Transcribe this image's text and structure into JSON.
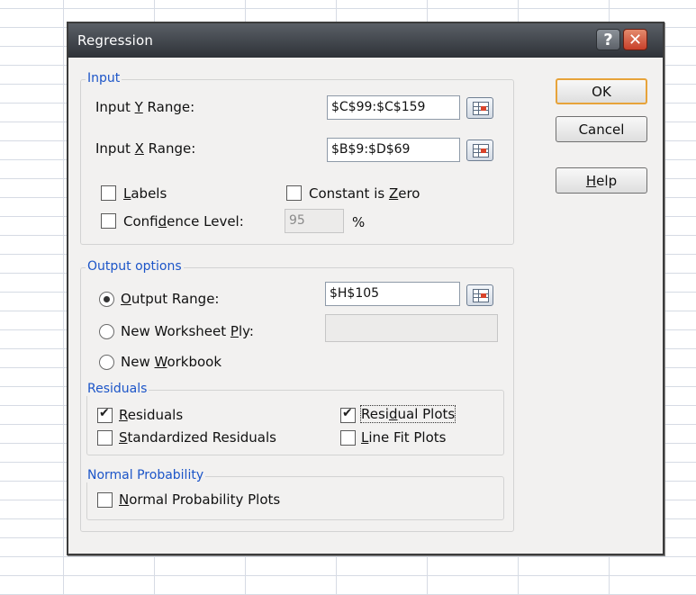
{
  "window": {
    "title": "Regression"
  },
  "buttons": {
    "ok": "OK",
    "cancel": "Cancel",
    "help": "Help",
    "help_char": "?",
    "close_char": "✕"
  },
  "input": {
    "group_title": "Input",
    "y_range_label": "Input Y Range:",
    "y_range_value": "$C$99:$C$159",
    "x_range_label": "Input X Range:",
    "x_range_value": "$B$9:$D$69",
    "labels": {
      "label": "Labels",
      "checked": false
    },
    "constant_zero": {
      "label": "Constant is Zero",
      "checked": false
    },
    "confidence": {
      "label": "Confidence Level:",
      "checked": false,
      "value": "95",
      "unit": "%"
    }
  },
  "output": {
    "group_title": "Output options",
    "output_range": {
      "label": "Output Range:",
      "selected": true,
      "value": "$H$105"
    },
    "new_worksheet": {
      "label": "New Worksheet Ply:",
      "selected": false,
      "value": ""
    },
    "new_workbook": {
      "label": "New Workbook",
      "selected": false
    }
  },
  "residuals": {
    "group_title": "Residuals",
    "residuals": {
      "label": "Residuals",
      "checked": true
    },
    "standardized": {
      "label": "Standardized Residuals",
      "checked": false
    },
    "residual_plots": {
      "label": "Residual Plots",
      "checked": true
    },
    "line_fit": {
      "label": "Line Fit Plots",
      "checked": false
    }
  },
  "normal": {
    "group_title": "Normal Probability",
    "plots": {
      "label": "Normal Probability Plots",
      "checked": false
    }
  }
}
